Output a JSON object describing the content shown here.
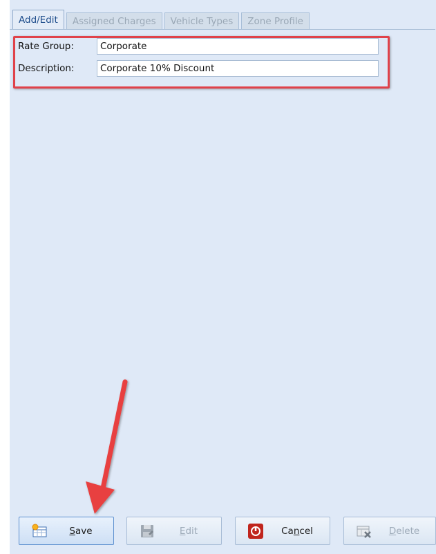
{
  "tabs": [
    {
      "label": "Add/Edit",
      "active": true
    },
    {
      "label": "Assigned Charges",
      "active": false
    },
    {
      "label": "Vehicle Types",
      "active": false
    },
    {
      "label": "Zone Profile",
      "active": false
    }
  ],
  "form": {
    "rate_group_label": "Rate Group:",
    "rate_group_value": "Corporate",
    "description_label": "Description:",
    "description_value": "Corporate 10% Discount"
  },
  "buttons": {
    "save": {
      "prefix": "",
      "underline": "S",
      "suffix": "ave",
      "enabled": true
    },
    "edit": {
      "prefix": "",
      "underline": "E",
      "suffix": "dit",
      "enabled": false
    },
    "cancel": {
      "prefix": "Ca",
      "underline": "n",
      "suffix": "cel",
      "enabled": true
    },
    "delete": {
      "prefix": "",
      "underline": "D",
      "suffix": "elete",
      "enabled": false
    }
  },
  "colors": {
    "background": "#dfe9f7",
    "highlight": "#e0424a",
    "arrow": "#e8403f",
    "cancel_icon": "#c0251d"
  },
  "icons": {
    "save": "grid-sun-icon",
    "edit": "floppy-disk-icon",
    "cancel": "power-stop-icon",
    "delete": "grid-delete-icon"
  }
}
